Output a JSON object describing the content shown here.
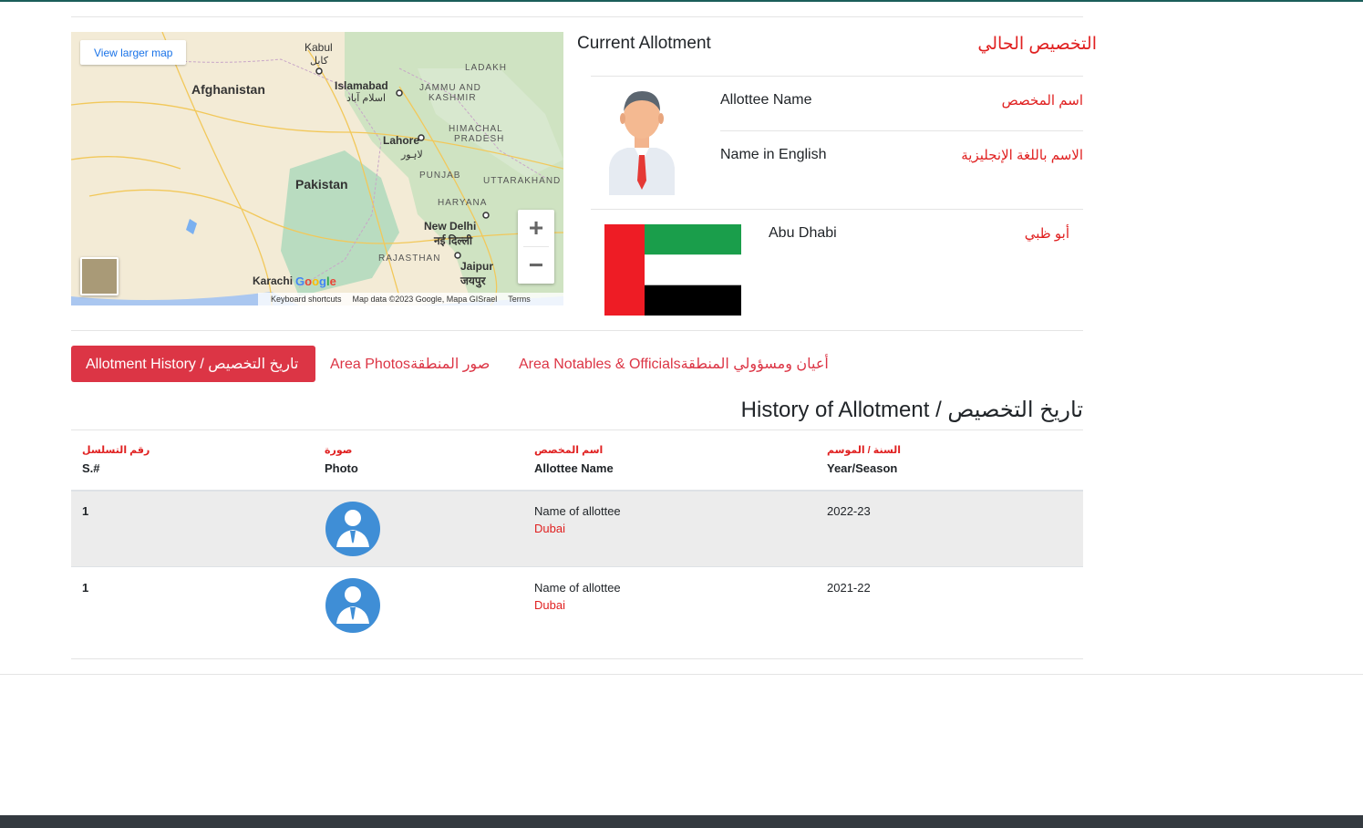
{
  "map": {
    "larger_map_link": "View larger map",
    "zoom_in": "+",
    "zoom_out": "−",
    "google_logo": "Google",
    "keyboard_shortcuts": "Keyboard shortcuts",
    "map_data": "Map data ©2023 Google, Mapa GISrael",
    "terms": "Terms",
    "labels": {
      "kabul": "Kabul",
      "kabul_ar": "کابل",
      "afghanistan": "Afghanistan",
      "islamabad": "Islamabad",
      "islamabad_ar": "اسلام آباد",
      "jammu_kashmir_1": "JAMMU AND",
      "jammu_kashmir_2": "KASHMIR",
      "ladakh": "LADAKH",
      "himachal_1": "HIMACHAL",
      "himachal_2": "PRADESH",
      "lahore": "Lahore",
      "lahore_ar": "لاہور",
      "punjab": "PUNJAB",
      "uttarakhand": "UTTARAKHAND",
      "pakistan": "Pakistan",
      "haryana": "HARYANA",
      "new_delhi": "New Delhi",
      "new_delhi_hi": "नई दिल्ली",
      "rajasthan": "RAJASTHAN",
      "jaipur": "Jaipur",
      "jaipur_hi": "जयपुर",
      "karachi": "Karachi"
    }
  },
  "current": {
    "title_en": "Current Allotment",
    "title_ar": "التخصيص الحالي",
    "allottee_name_en": "Allottee Name",
    "allottee_name_ar": "اسم المخصص",
    "name_english_en": "Name in English",
    "name_english_ar": "الاسم باللغة الإنجليزية",
    "location_en": "Abu Dhabi",
    "location_ar": "أبو ظبي"
  },
  "tabs": [
    {
      "label": "Allotment History /  تاريخ التخصيص"
    },
    {
      "label": "Area Photosصور المنطقة"
    },
    {
      "label": "Area Notables & Officialsأعيان ومسؤولي المنطقة"
    }
  ],
  "history_title": "History of Allotment /  تاريخ التخصيص",
  "table": {
    "headers": [
      {
        "ar": "رقم التسلسل",
        "en": "S.#"
      },
      {
        "ar": "صورة",
        "en": "Photo"
      },
      {
        "ar": "اسم المخصص",
        "en": "Allottee Name"
      },
      {
        "ar": "السنة / الموسم",
        "en": "Year/Season"
      }
    ],
    "rows": [
      {
        "sn": "1",
        "name": "Name of allottee",
        "city": "Dubai",
        "year": "2022-23"
      },
      {
        "sn": "1",
        "name": "Name of allottee",
        "city": "Dubai",
        "year": "2021-22"
      }
    ]
  },
  "colors": {
    "accent_red": "#dc3545",
    "arabic_red": "#e02020",
    "footer": "#343a40",
    "topbar": "#1b5e5a"
  }
}
